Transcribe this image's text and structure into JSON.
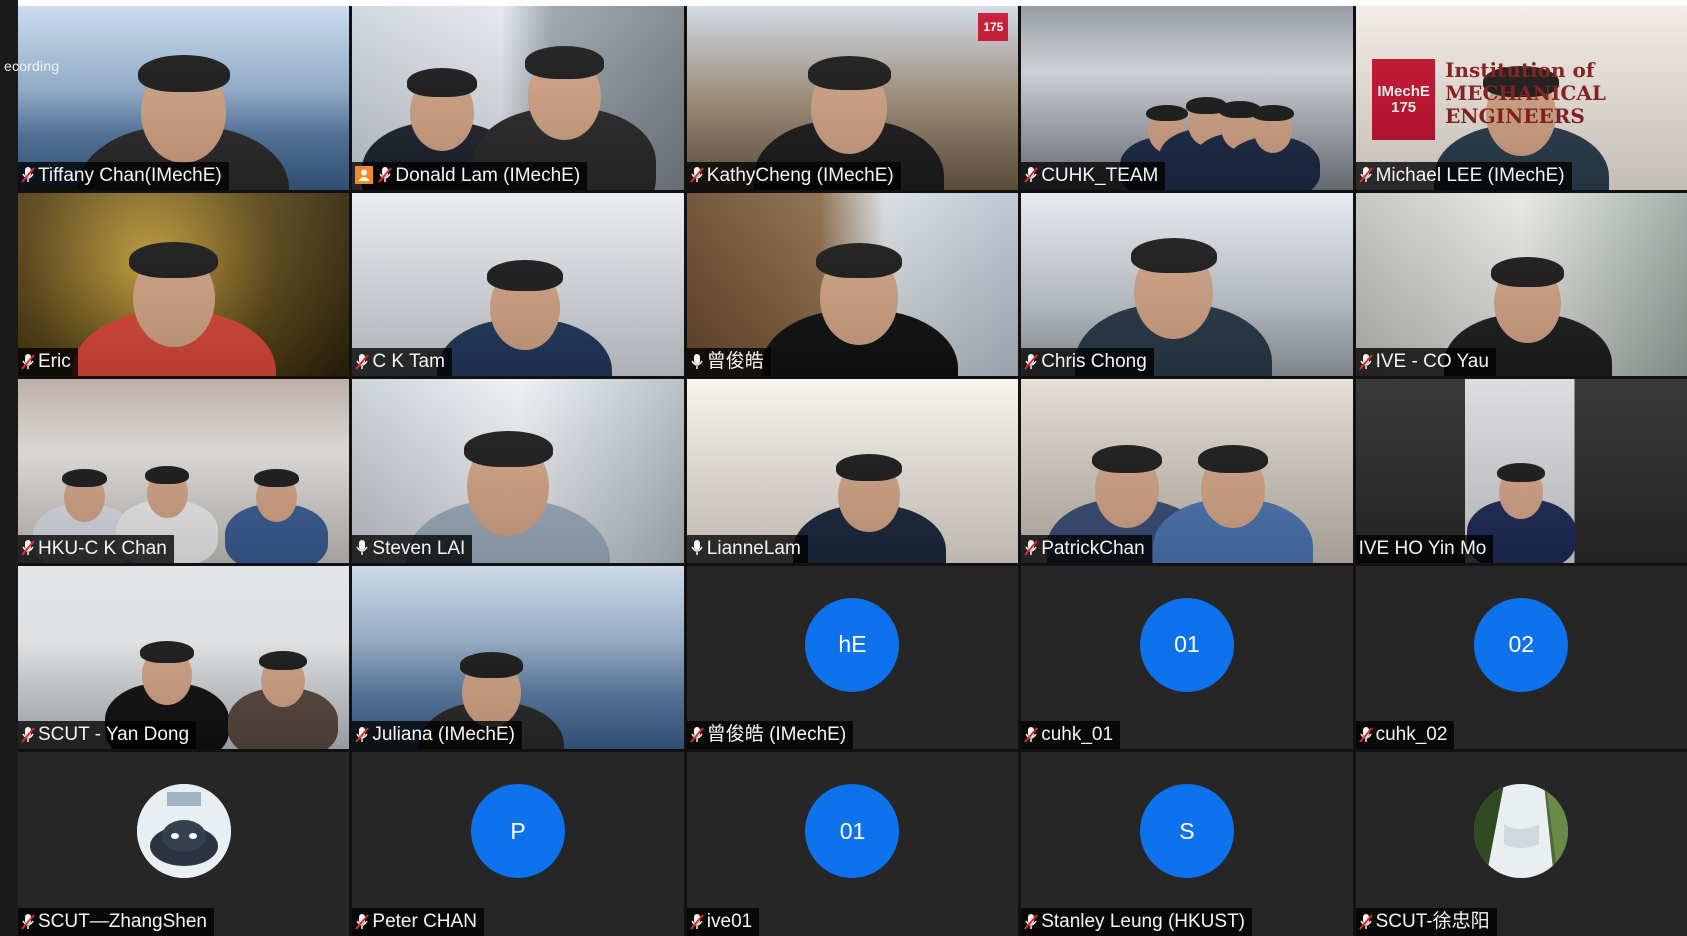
{
  "recording_label": "ecording",
  "colors": {
    "avatar_blue": "#0e72ed",
    "name_badge_bg": "#000000",
    "host_badge": "#f28a2b"
  },
  "participants": [
    {
      "name": "Tiffany Chan(IMechE)",
      "video": true,
      "mic": "muted-icon"
    },
    {
      "name": "Donald Lam (IMechE)",
      "video": true,
      "mic": "muted-icon",
      "host": true
    },
    {
      "name": "KathyCheng (IMechE)",
      "video": true,
      "mic": "muted-icon",
      "logo_text": "175"
    },
    {
      "name": "CUHK_TEAM",
      "video": true,
      "mic": "muted-icon"
    },
    {
      "name": "Michael LEE (IMechE)",
      "video": true,
      "mic": "muted-icon",
      "logo_text": "IMechE 175",
      "banner_text": "Institution of MECHANICAL ENGINEERS"
    },
    {
      "name": "Eric",
      "video": true,
      "mic": "muted-icon"
    },
    {
      "name": "C K Tam",
      "video": true,
      "mic": "muted-icon"
    },
    {
      "name": "曾俊皓",
      "video": true,
      "mic": "mic-on-icon"
    },
    {
      "name": "Chris Chong",
      "video": true,
      "mic": "muted-icon"
    },
    {
      "name": "IVE - CO Yau",
      "video": true,
      "mic": "muted-icon"
    },
    {
      "name": "HKU-C K Chan",
      "video": true,
      "mic": "muted-icon"
    },
    {
      "name": "Steven LAI",
      "video": true,
      "mic": "mic-on-icon"
    },
    {
      "name": "LianneLam",
      "video": true,
      "mic": "mic-on-icon"
    },
    {
      "name": "PatrickChan",
      "video": true,
      "mic": "muted-icon"
    },
    {
      "name": "IVE HO Yin Mo",
      "video": true,
      "mic": "none"
    },
    {
      "name": "SCUT - Yan Dong",
      "video": true,
      "mic": "muted-icon"
    },
    {
      "name": "Juliana (IMechE)",
      "video": true,
      "mic": "muted-icon"
    },
    {
      "name": "曾俊皓 (IMechE)",
      "video": false,
      "mic": "muted-icon",
      "avatar_text": "hE"
    },
    {
      "name": "cuhk_01",
      "video": false,
      "mic": "muted-icon",
      "avatar_text": "01"
    },
    {
      "name": "cuhk_02",
      "video": false,
      "mic": "muted-icon",
      "avatar_text": "02"
    },
    {
      "name": "SCUT—ZhangShen",
      "video": false,
      "mic": "muted-icon",
      "avatar_image": "cartoon-dog-avatar"
    },
    {
      "name": "Peter CHAN",
      "video": false,
      "mic": "muted-icon",
      "avatar_text": "P"
    },
    {
      "name": "ive01",
      "video": false,
      "mic": "muted-icon",
      "avatar_text": "01"
    },
    {
      "name": "Stanley Leung (HKUST)",
      "video": false,
      "mic": "muted-icon",
      "avatar_text": "S"
    },
    {
      "name": "SCUT-徐忠阳",
      "video": false,
      "mic": "muted-icon",
      "avatar_image": "waterfall-photo-avatar"
    }
  ]
}
